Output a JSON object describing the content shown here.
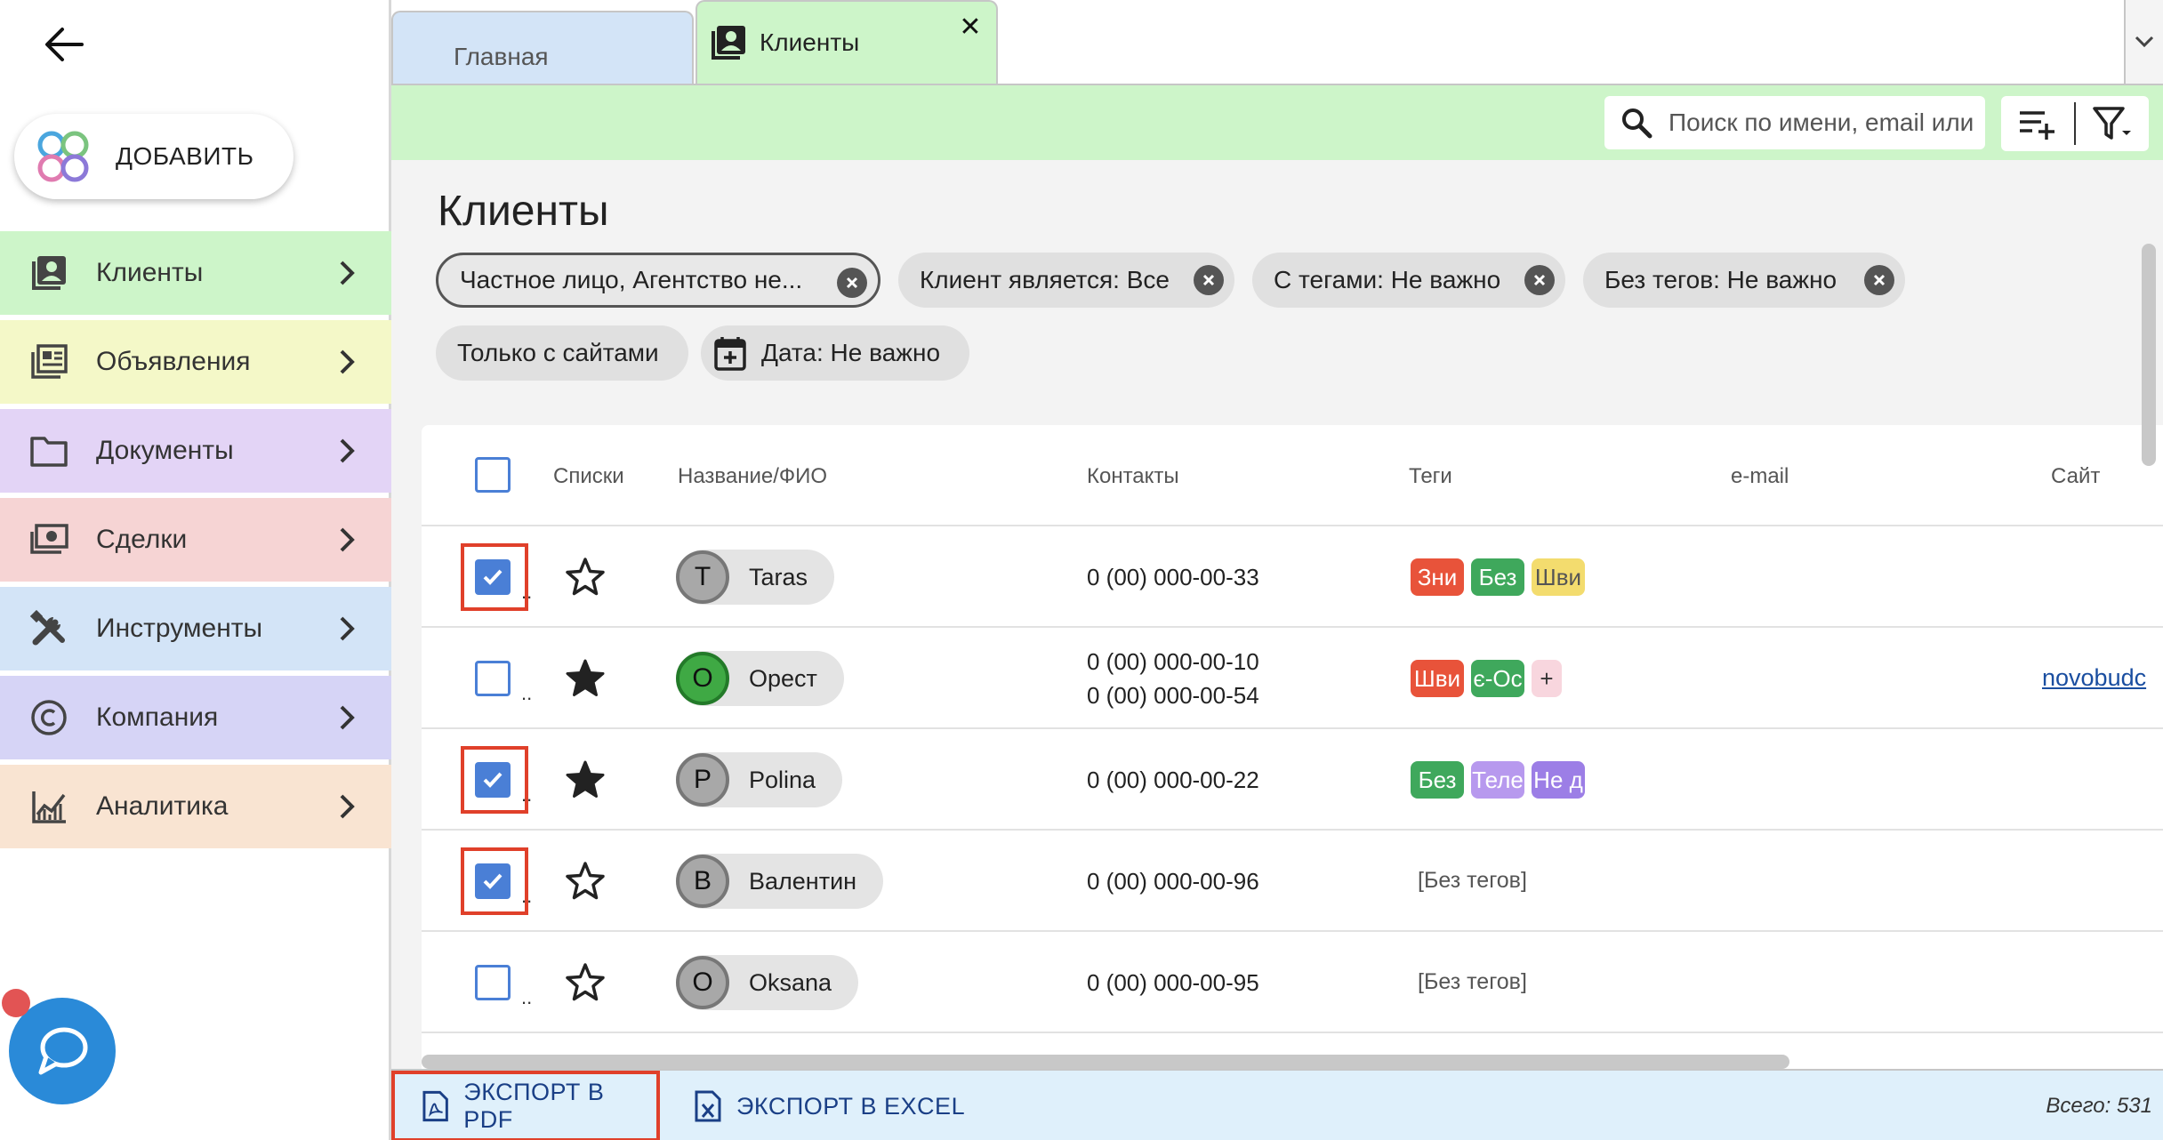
{
  "sidebar": {
    "add_label": "ДОБАВИТЬ",
    "items": [
      {
        "label": "Клиенты",
        "icon": "contacts-icon",
        "color": "#cdf5c9"
      },
      {
        "label": "Объявления",
        "icon": "listings-icon",
        "color": "#f4f8c8"
      },
      {
        "label": "Документы",
        "icon": "folder-icon",
        "color": "#e3d4f6"
      },
      {
        "label": "Сделки",
        "icon": "money-icon",
        "color": "#f6d4d4"
      },
      {
        "label": "Инструменты",
        "icon": "tools-icon",
        "color": "#d3e4f7"
      },
      {
        "label": "Компания",
        "icon": "copyright-icon",
        "color": "#d6d4f6"
      },
      {
        "label": "Аналитика",
        "icon": "analytics-icon",
        "color": "#f9e4d2"
      }
    ]
  },
  "tabs": {
    "home_label": "Главная",
    "clients_label": "Клиенты",
    "close_glyph": "✕"
  },
  "toolbar": {
    "search_placeholder": "Поиск по имени, email или"
  },
  "main": {
    "title": "Клиенты",
    "chips": [
      "Частное лицо, Агентство не...",
      "Клиент является: Все",
      "С тегами: Не важно",
      "Без тегов: Не важно",
      "Только с сайтами",
      "Дата: Не важно"
    ]
  },
  "table": {
    "headers": [
      "Списки",
      "Название/ФИО",
      "Контакты",
      "Теги",
      "e-mail",
      "Сайт"
    ],
    "rows": [
      {
        "checked": true,
        "starred": false,
        "initial": "T",
        "name": "Taras",
        "contacts": [
          "0 (00) 000-00-33"
        ],
        "tags": [
          {
            "text": "Зни",
            "color": "#e8533a"
          },
          {
            "text": "Без",
            "color": "#3fa85c"
          },
          {
            "text": "Шви",
            "color": "#f3dc6e",
            "fg": "#555"
          }
        ],
        "notags": "",
        "site": ""
      },
      {
        "checked": false,
        "starred": true,
        "initial": "О",
        "name": "Орест",
        "contacts": [
          "0 (00) 000-00-10",
          "0 (00) 000-00-54"
        ],
        "tags": [
          {
            "text": "Шви",
            "color": "#e8533a"
          },
          {
            "text": "є-Ос",
            "color": "#3fa85c"
          },
          {
            "text": "+",
            "color": "#f8d6de",
            "fg": "#333"
          }
        ],
        "notags": "",
        "site": "novobudc"
      },
      {
        "checked": true,
        "starred": true,
        "initial": "P",
        "name": "Polina",
        "contacts": [
          "0 (00) 000-00-22"
        ],
        "tags": [
          {
            "text": "Без",
            "color": "#3fa85c"
          },
          {
            "text": "Теле",
            "color": "#b799ee"
          },
          {
            "text": "Не д",
            "color": "#9c7ee6"
          }
        ],
        "notags": "",
        "site": ""
      },
      {
        "checked": true,
        "starred": false,
        "initial": "В",
        "name": "Валентин",
        "contacts": [
          "0 (00) 000-00-96"
        ],
        "tags": [],
        "notags": "[Без тегов]",
        "site": ""
      },
      {
        "checked": false,
        "starred": false,
        "initial": "O",
        "name": "Oksana",
        "contacts": [
          "0 (00) 000-00-95"
        ],
        "tags": [],
        "notags": "[Без тегов]",
        "site": ""
      }
    ],
    "row_dots": ".."
  },
  "footer": {
    "pdf_label": "ЭКСПОРТ В PDF",
    "excel_label": "ЭКСПОРТ В EXCEL",
    "total_text": "Всего: 531"
  }
}
